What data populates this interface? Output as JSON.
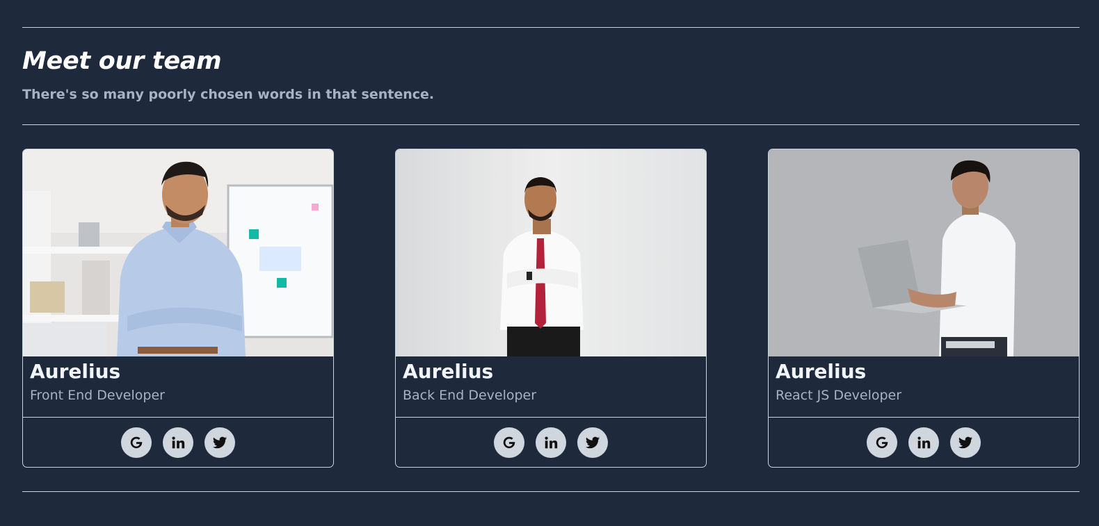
{
  "section": {
    "title": "Meet our team",
    "subtitle": "There's so many poorly chosen words in that sentence."
  },
  "team": [
    {
      "name": "Aurelius",
      "role": "Front End Developer",
      "photo_icon": "person-office-photo",
      "social": [
        "google-icon",
        "linkedin-icon",
        "twitter-icon"
      ]
    },
    {
      "name": "Aurelius",
      "role": "Back End Developer",
      "photo_icon": "person-tie-photo",
      "social": [
        "google-icon",
        "linkedin-icon",
        "twitter-icon"
      ]
    },
    {
      "name": "Aurelius",
      "role": "React JS Developer",
      "photo_icon": "person-laptop-photo",
      "social": [
        "google-icon",
        "linkedin-icon",
        "twitter-icon"
      ]
    }
  ],
  "colors": {
    "background": "#1e293b",
    "border": "#cbd5e1",
    "muted_text": "#a7b3c4",
    "social_button": "#cfd6de"
  }
}
